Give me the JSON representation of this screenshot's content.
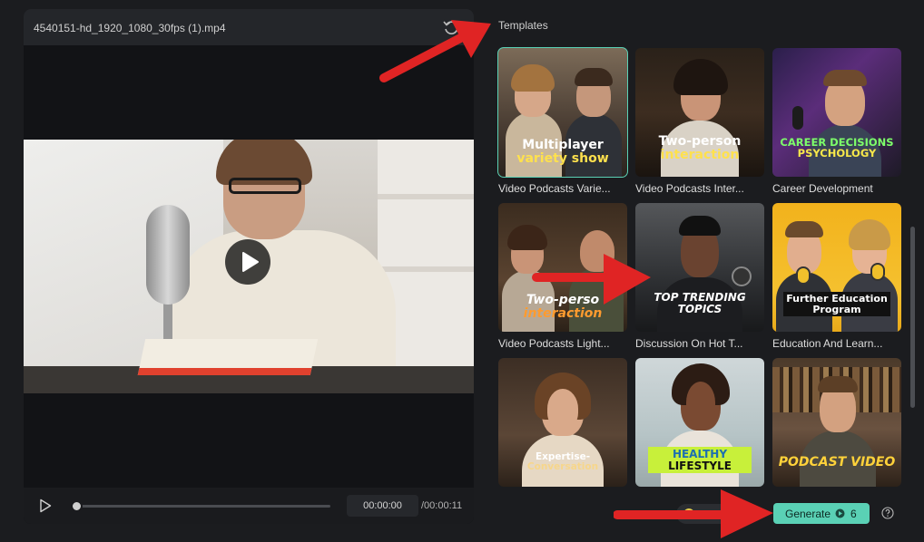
{
  "preview": {
    "file_name": "4540151-hd_1920_1080_30fps (1).mp4",
    "time_current": "00:00:00",
    "time_total": "/00:00:11",
    "progress": 0
  },
  "templates": {
    "title": "Templates",
    "cards": [
      {
        "label": "Video Podcasts Varie...",
        "caption": [
          "Multiplayer",
          "variety show"
        ],
        "selected": true
      },
      {
        "label": "Video Podcasts Inter...",
        "caption": [
          "Two-person",
          "interaction"
        ],
        "selected": false
      },
      {
        "label": "Career Development",
        "caption": [
          "CAREER DECISIONS",
          "PSYCHOLOGY"
        ],
        "selected": false
      },
      {
        "label": "Video Podcasts Light...",
        "caption": [
          "Two-perso",
          "interaction"
        ],
        "selected": false
      },
      {
        "label": "Discussion On Hot T...",
        "caption": [
          "TOP TRENDING",
          "TOPICS"
        ],
        "selected": false
      },
      {
        "label": "Education And Learn...",
        "caption": [
          "Further Education",
          "Program"
        ],
        "selected": false
      },
      {
        "label": "",
        "caption": [
          "Expertise-",
          "Conversation"
        ],
        "selected": false
      },
      {
        "label": "",
        "caption": [
          "HEALTHY",
          "LIFESTYLE"
        ],
        "selected": false
      },
      {
        "label": "",
        "caption": [
          "PODCAST VIDEO"
        ],
        "selected": false
      }
    ]
  },
  "footer": {
    "generate_label": "Generate",
    "credits": "6"
  },
  "colors": {
    "accent": "#5ad1b5",
    "annotation": "#e02424"
  }
}
